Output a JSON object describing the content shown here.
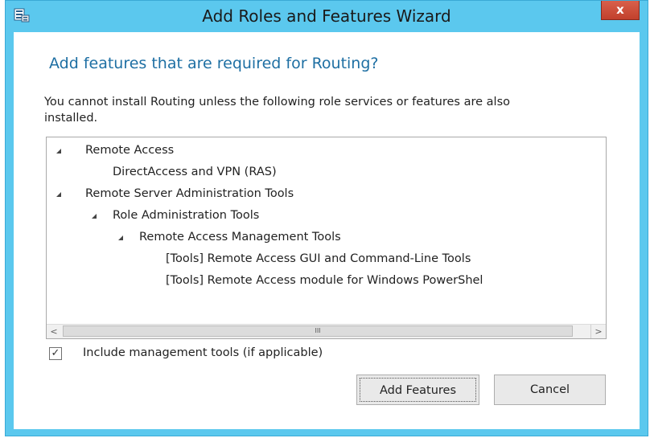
{
  "window": {
    "title": "Add Roles and Features Wizard",
    "close_label": "x",
    "accent_color": "#5bc8ee"
  },
  "dialog": {
    "heading": "Add features that are required for Routing?",
    "message": "You cannot install Routing unless the following role services or features are also installed.",
    "tree": [
      {
        "label": "Remote Access",
        "level": 0,
        "expanded": true
      },
      {
        "label": "DirectAccess and VPN (RAS)",
        "level": 1,
        "expanded": false
      },
      {
        "label": "Remote Server Administration Tools",
        "level": 0,
        "expanded": true
      },
      {
        "label": "Role Administration Tools",
        "level": 1,
        "expanded": true
      },
      {
        "label": "Remote Access Management Tools",
        "level": 2,
        "expanded": true
      },
      {
        "label": "[Tools] Remote Access GUI and Command-Line Tools",
        "level": 3,
        "expanded": false
      },
      {
        "label": "[Tools] Remote Access module for Windows PowerShel",
        "level": 3,
        "expanded": false
      }
    ],
    "scrollbar": {
      "left_arrow": "<",
      "right_arrow": ">",
      "thumb_grip": "III"
    },
    "include_tools": {
      "label": "Include management tools (if applicable)",
      "checked": true,
      "check_glyph": "✓"
    },
    "buttons": {
      "add_features": "Add Features",
      "cancel": "Cancel"
    }
  }
}
